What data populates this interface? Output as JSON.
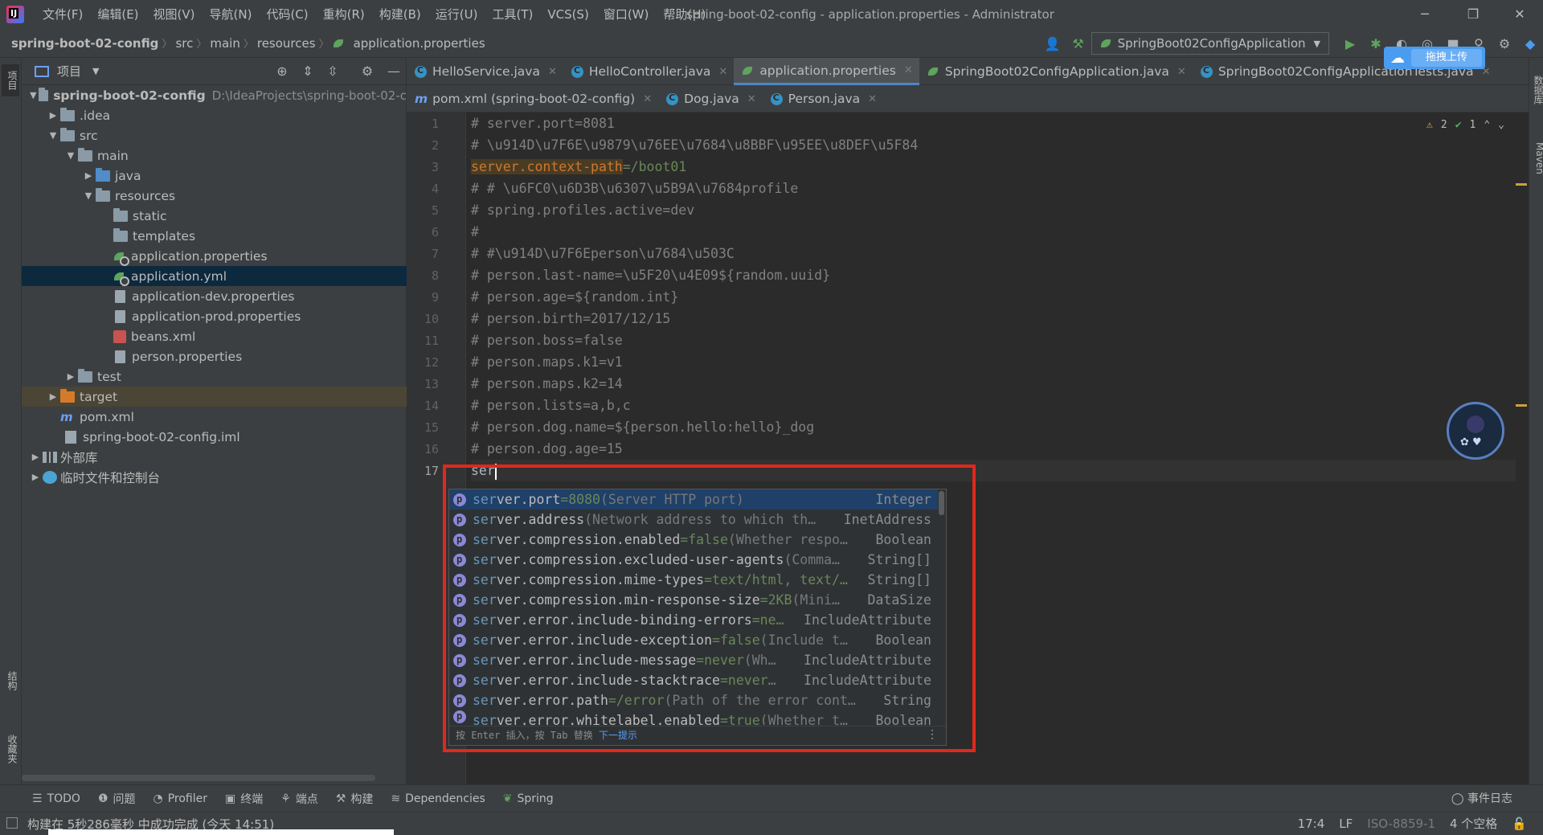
{
  "window": {
    "title": "spring-boot-02-config - application.properties - Administrator",
    "menus": [
      "文件(F)",
      "编辑(E)",
      "视图(V)",
      "导航(N)",
      "代码(C)",
      "重构(R)",
      "构建(B)",
      "运行(U)",
      "工具(T)",
      "VCS(S)",
      "窗口(W)",
      "帮助(H)"
    ],
    "minimize": "─",
    "restore": "❐",
    "close": "✕"
  },
  "breadcrumb": [
    "spring-boot-02-config",
    "src",
    "main",
    "resources",
    "application.properties"
  ],
  "toolbar": {
    "run_config": "SpringBoot02ConfigApplication",
    "upload_label": "拖拽上传"
  },
  "project_panel": {
    "title": "项目",
    "root_path": "D:\\IdeaProjects\\spring-boot-02-c",
    "tree": [
      {
        "label": "spring-boot-02-config",
        "depth": 0,
        "kind": "module"
      },
      {
        "label": ".idea",
        "depth": 1,
        "kind": "folder"
      },
      {
        "label": "src",
        "depth": 1,
        "kind": "folder"
      },
      {
        "label": "main",
        "depth": 2,
        "kind": "folder"
      },
      {
        "label": "java",
        "depth": 3,
        "kind": "folder-blue"
      },
      {
        "label": "resources",
        "depth": 3,
        "kind": "folder-res"
      },
      {
        "label": "static",
        "depth": 4,
        "kind": "folder"
      },
      {
        "label": "templates",
        "depth": 4,
        "kind": "folder"
      },
      {
        "label": "application.properties",
        "depth": 4,
        "kind": "spring"
      },
      {
        "label": "application.yml",
        "depth": 4,
        "kind": "spring"
      },
      {
        "label": "application-dev.properties",
        "depth": 4,
        "kind": "file"
      },
      {
        "label": "application-prod.properties",
        "depth": 4,
        "kind": "file"
      },
      {
        "label": "beans.xml",
        "depth": 4,
        "kind": "xml"
      },
      {
        "label": "person.properties",
        "depth": 4,
        "kind": "file"
      },
      {
        "label": "test",
        "depth": 2,
        "kind": "folder"
      },
      {
        "label": "target",
        "depth": 1,
        "kind": "folder-orange"
      },
      {
        "label": "pom.xml",
        "depth": 1,
        "kind": "maven"
      },
      {
        "label": "spring-boot-02-config.iml",
        "depth": 1,
        "kind": "iml"
      },
      {
        "label": "外部库",
        "depth": 0,
        "kind": "lib"
      },
      {
        "label": "临时文件和控制台",
        "depth": 0,
        "kind": "scratch"
      }
    ]
  },
  "left_stripe": {
    "project": "项目",
    "structure": "结构",
    "favorites": "收藏夹"
  },
  "right_stripe": {
    "database": "数据库",
    "maven": "Maven"
  },
  "tabs_row1": [
    "HelloService.java",
    "HelloController.java",
    "application.properties",
    "SpringBoot02ConfigApplication.java",
    "SpringBoot02ConfigApplicationTests.java"
  ],
  "tabs_row2": [
    "pom.xml (spring-boot-02-config)",
    "Dog.java",
    "Person.java"
  ],
  "editor": {
    "lines": [
      "# server.port=8081",
      "# \\u914D\\u7F6E\\u9879\\u76EE\\u7684\\u8BBF\\u95EE\\u8DEF\\u5F84",
      "server.context-path=/boot01",
      "# # \\u6FC0\\u6D3B\\u6307\\u5B9A\\u7684profile",
      "# spring.profiles.active=dev",
      "#",
      "# #\\u914D\\u7F6Eperson\\u7684\\u503C",
      "# person.last-name=\\u5F20\\u4E09${random.uuid}",
      "# person.age=${random.int}",
      "# person.birth=2017/12/15",
      "# person.boss=false",
      "# person.maps.k1=v1",
      "# person.maps.k2=14",
      "# person.lists=a,b,c",
      "# person.dog.name=${person.hello:hello}_dog",
      "# person.dog.age=15",
      "ser"
    ],
    "line3_key": "server.context-path",
    "line3_value": "=/boot01",
    "inspection": {
      "warnings": "2",
      "ok": "1"
    }
  },
  "completion": {
    "prefix": "ser",
    "items": [
      {
        "rest": "ver.port",
        "default": "=8080",
        "desc": " (Server HTTP port)",
        "type": "Integer"
      },
      {
        "rest": "ver.address",
        "default": "",
        "desc": " (Network address to which th…",
        "type": "InetAddress"
      },
      {
        "rest": "ver.compression.enabled",
        "default": "=false",
        "desc": " (Whether respo…",
        "type": "Boolean"
      },
      {
        "rest": "ver.compression.excluded-user-agents",
        "default": "",
        "desc": " (Comma…",
        "type": "String[]"
      },
      {
        "rest": "ver.compression.mime-types",
        "default": "=text/html, text/…",
        "desc": "",
        "type": "String[]"
      },
      {
        "rest": "ver.compression.min-response-size",
        "default": "=2KB",
        "desc": " (Mini…",
        "type": "DataSize"
      },
      {
        "rest": "ver.error.include-binding-errors",
        "default": "=ne…",
        "desc": "",
        "type": "IncludeAttribute"
      },
      {
        "rest": "ver.error.include-exception",
        "default": "=false",
        "desc": " (Include t…",
        "type": "Boolean"
      },
      {
        "rest": "ver.error.include-message",
        "default": "=never",
        "desc": " (Wh…",
        "type": "IncludeAttribute"
      },
      {
        "rest": "ver.error.include-stacktrace",
        "default": "=never",
        "desc": " …",
        "type": "IncludeAttribute"
      },
      {
        "rest": "ver.error.path",
        "default": "=/error",
        "desc": " (Path of the error cont…",
        "type": "String"
      },
      {
        "rest": "ver.error.whitelabel.enabled",
        "default": "=true",
        "desc": " (Whether t…",
        "type": "Boolean"
      }
    ],
    "footer_hint": "按 Enter 插入，按 Tab 替换",
    "footer_link": "下一提示"
  },
  "bottom_tools": [
    "TODO",
    "问题",
    "Profiler",
    "终端",
    "端点",
    "构建",
    "Dependencies",
    "Spring"
  ],
  "event_log": "事件日志",
  "status": {
    "message": "构建在 5秒286毫秒 中成功完成 (今天 14:51)",
    "position": "17:4",
    "line_sep": "LF",
    "encoding": "ISO-8859-1",
    "indent": "4 个空格"
  }
}
